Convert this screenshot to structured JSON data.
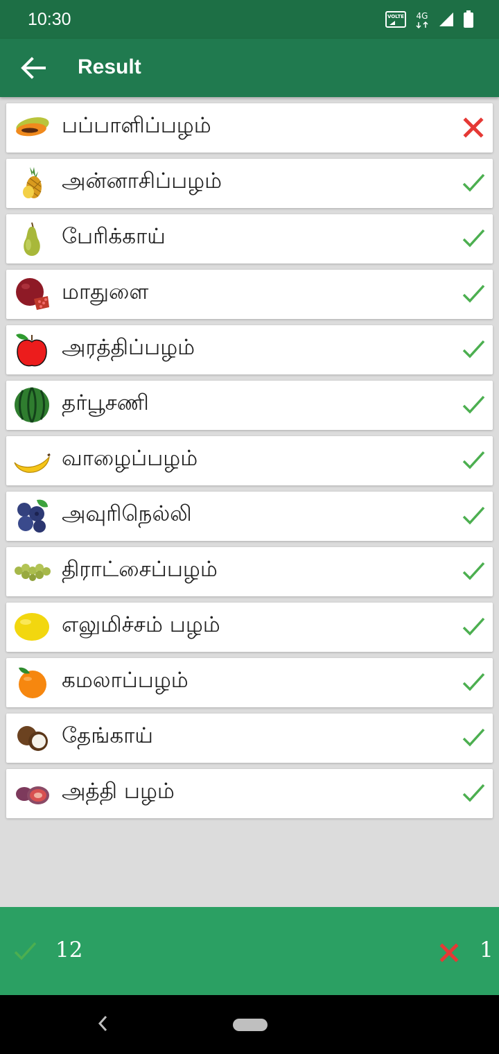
{
  "status_bar": {
    "time": "10:30",
    "network": "4G",
    "volte_label": "VOLTE"
  },
  "app_bar": {
    "title": "Result",
    "back_icon": "arrow-left-icon"
  },
  "colors": {
    "primary_dark": "#1d6f45",
    "primary": "#207a4f",
    "footer": "#2ba063",
    "correct": "#4caf50",
    "wrong": "#e53935"
  },
  "results": [
    {
      "name": "பப்பாளிப்பழம்",
      "icon": "papaya-icon",
      "correct": false
    },
    {
      "name": "அன்னாசிப்பழம்",
      "icon": "pineapple-icon",
      "correct": true
    },
    {
      "name": "பேரிக்காய்",
      "icon": "pear-icon",
      "correct": true
    },
    {
      "name": "மாதுளை",
      "icon": "pomegranate-icon",
      "correct": true
    },
    {
      "name": "அரத்திப்பழம்",
      "icon": "apple-icon",
      "correct": true
    },
    {
      "name": "தர்பூசணி",
      "icon": "watermelon-icon",
      "correct": true
    },
    {
      "name": "வாழைப்பழம்",
      "icon": "banana-icon",
      "correct": true
    },
    {
      "name": "அவுரிநெல்லி",
      "icon": "blueberry-icon",
      "correct": true
    },
    {
      "name": "திராட்சைப்பழம்",
      "icon": "grapes-icon",
      "correct": true
    },
    {
      "name": "எலுமிச்சம் பழம்",
      "icon": "lemon-icon",
      "correct": true
    },
    {
      "name": "கமலாப்பழம்",
      "icon": "orange-icon",
      "correct": true
    },
    {
      "name": "தேங்காய்",
      "icon": "coconut-icon",
      "correct": true
    },
    {
      "name": "அத்தி பழம்",
      "icon": "fig-icon",
      "correct": true
    }
  ],
  "footer": {
    "correct_count": "12",
    "wrong_count": "1"
  }
}
